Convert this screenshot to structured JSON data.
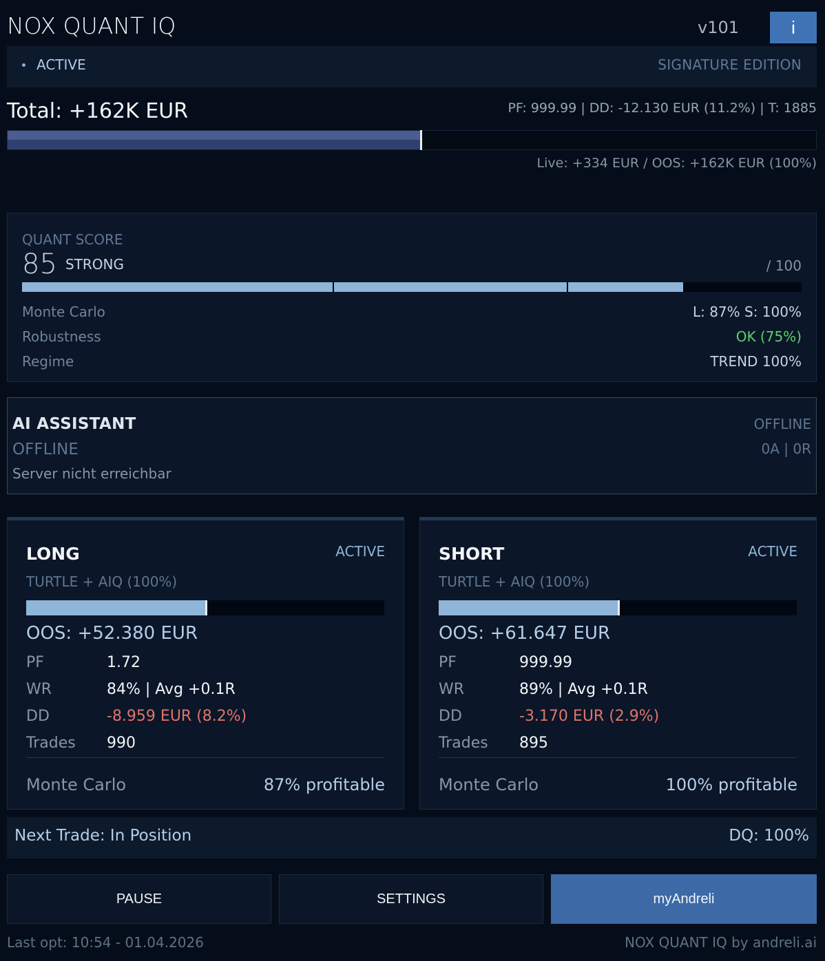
{
  "header": {
    "title": "NOX QUANT IQ",
    "version": "v101",
    "info_label": "i"
  },
  "status": {
    "state": "ACTIVE",
    "edition": "SIGNATURE EDITION"
  },
  "totals": {
    "total_text": "Total: +162K EUR",
    "stats_text": "PF: 999.99 | DD: -12.130 EUR (11.2%) | T: 1885",
    "live_text": "Live: +334 EUR / OOS: +162K EUR (100%)",
    "progress_fraction": 0.5
  },
  "quant": {
    "label": "QUANT SCORE",
    "score": "85",
    "grade": "STRONG",
    "max": "/ 100",
    "score_value": 85,
    "metrics": [
      {
        "label": "Monte Carlo",
        "value": "L: 87%  S: 100%"
      },
      {
        "label": "Robustness",
        "value": "OK (75%)"
      },
      {
        "label": "Regime",
        "value": "TREND 100%"
      }
    ]
  },
  "ai": {
    "title": "AI ASSISTANT",
    "status": "OFFLINE",
    "message": "Server nicht erreichbar",
    "right_status": "OFFLINE",
    "counts": "0A | 0R"
  },
  "long": {
    "title": "LONG",
    "status": "ACTIVE",
    "strategy": "TURTLE + AIQ (100%)",
    "progress_fraction": 0.5,
    "oos": "OOS: +52.380 EUR",
    "rows": [
      {
        "label": "PF",
        "value": "1.72"
      },
      {
        "label": "WR",
        "value": "84% | Avg +0.1R"
      },
      {
        "label": "DD",
        "value": "-8.959 EUR (8.2%)"
      },
      {
        "label": "Trades",
        "value": "990"
      }
    ],
    "mc_label": "Monte Carlo",
    "mc_value": "87% profitable"
  },
  "short": {
    "title": "SHORT",
    "status": "ACTIVE",
    "strategy": "TURTLE + AIQ (100%)",
    "progress_fraction": 0.5,
    "oos": "OOS: +61.647 EUR",
    "rows": [
      {
        "label": "PF",
        "value": "999.99"
      },
      {
        "label": "WR",
        "value": "89% | Avg +0.1R"
      },
      {
        "label": "DD",
        "value": "-3.170 EUR (2.9%)"
      },
      {
        "label": "Trades",
        "value": "895"
      }
    ],
    "mc_label": "Monte Carlo",
    "mc_value": "100% profitable"
  },
  "next": {
    "trade": "Next Trade: In Position",
    "dq": "DQ: 100%"
  },
  "buttons": {
    "pause": "PAUSE",
    "settings": "SETTINGS",
    "account": "myAndreli"
  },
  "footer": {
    "last_opt": "Last opt: 10:54 - 01.04.2026",
    "brand": "NOX QUANT IQ by andreli.ai"
  },
  "colors": {
    "accent": "#3f73b5",
    "bar": "#8fb5d8",
    "ok": "#5fcf6e",
    "negative": "#e27369"
  }
}
